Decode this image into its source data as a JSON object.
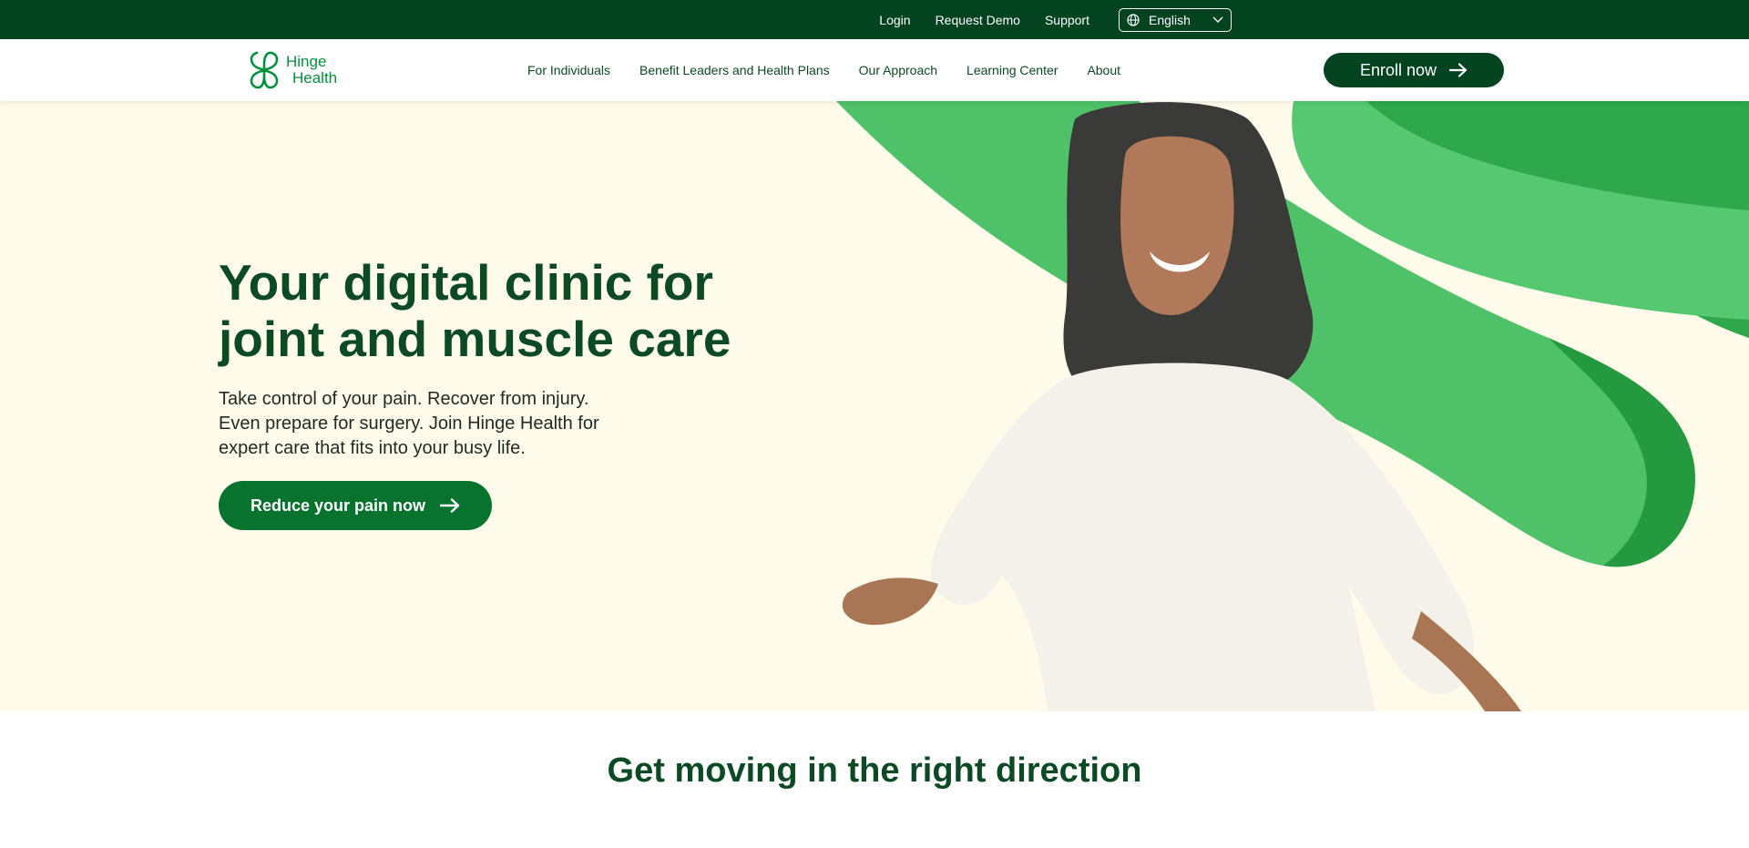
{
  "utility_bar": {
    "login": "Login",
    "request_demo": "Request Demo",
    "support": "Support",
    "language": "English",
    "icons": [
      "globe-icon",
      "chevron-down-icon"
    ]
  },
  "nav": {
    "logo_line1": "Hinge",
    "logo_line2": "Health",
    "items": [
      {
        "label": "For Individuals"
      },
      {
        "label": "Benefit Leaders and Health Plans"
      },
      {
        "label": "Our Approach"
      },
      {
        "label": "Learning Center"
      },
      {
        "label": "About"
      }
    ],
    "enroll_label": "Enroll now"
  },
  "hero": {
    "title_line1": "Your digital clinic for",
    "title_line2": "joint and muscle care",
    "subtitle_line1": "Take control of your pain. Recover from injury.",
    "subtitle_line2": "Even prepare for surgery. Join Hinge Health for",
    "subtitle_line3": "expert care that fits into your busy life.",
    "cta_label": "Reduce your pain now"
  },
  "section": {
    "title": "Get moving in the right direction"
  },
  "colors": {
    "brand_dark": "#034320",
    "brand_green": "#08732f",
    "accent_green": "#22b14c",
    "hero_bg": "#fffbeb"
  }
}
